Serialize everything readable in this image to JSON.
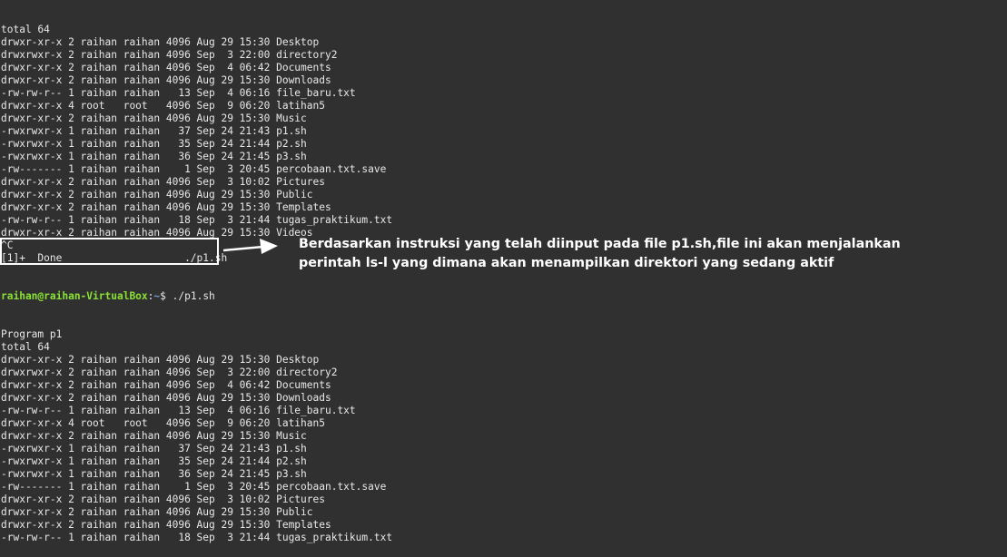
{
  "terminal": {
    "lines_before": [
      "total 64",
      "drwxr-xr-x 2 raihan raihan 4096 Aug 29 15:30 Desktop",
      "drwxrwxr-x 2 raihan raihan 4096 Sep  3 22:00 directory2",
      "drwxr-xr-x 2 raihan raihan 4096 Sep  4 06:42 Documents",
      "drwxr-xr-x 2 raihan raihan 4096 Aug 29 15:30 Downloads",
      "-rw-rw-r-- 1 raihan raihan   13 Sep  4 06:16 file_baru.txt",
      "drwxr-xr-x 4 root   root   4096 Sep  9 06:20 latihan5",
      "drwxr-xr-x 2 raihan raihan 4096 Aug 29 15:30 Music",
      "-rwxrwxr-x 1 raihan raihan   37 Sep 24 21:43 p1.sh",
      "-rwxrwxr-x 1 raihan raihan   35 Sep 24 21:44 p2.sh",
      "-rwxrwxr-x 1 raihan raihan   36 Sep 24 21:45 p3.sh",
      "-rw------- 1 raihan raihan    1 Sep  3 20:45 percobaan.txt.save",
      "drwxr-xr-x 2 raihan raihan 4096 Sep  3 10:02 Pictures",
      "drwxr-xr-x 2 raihan raihan 4096 Aug 29 15:30 Public",
      "drwxr-xr-x 2 raihan raihan 4096 Aug 29 15:30 Templates",
      "-rw-rw-r-- 1 raihan raihan   18 Sep  3 21:44 tugas_praktikum.txt",
      "drwxr-xr-x 2 raihan raihan 4096 Aug 29 15:30 Videos",
      "^C",
      "[1]+  Done                    ./p1.sh"
    ],
    "prompt": {
      "user_host": "raihan@raihan-VirtualBox",
      "separator": ":",
      "path": "~",
      "symbol": "$ ",
      "command": "./p1.sh"
    },
    "lines_after": [
      "Program p1",
      "total 64",
      "drwxr-xr-x 2 raihan raihan 4096 Aug 29 15:30 Desktop",
      "drwxrwxr-x 2 raihan raihan 4096 Sep  3 22:00 directory2",
      "drwxr-xr-x 2 raihan raihan 4096 Sep  4 06:42 Documents",
      "drwxr-xr-x 2 raihan raihan 4096 Aug 29 15:30 Downloads",
      "-rw-rw-r-- 1 raihan raihan   13 Sep  4 06:16 file_baru.txt",
      "drwxr-xr-x 4 root   root   4096 Sep  9 06:20 latihan5",
      "drwxr-xr-x 2 raihan raihan 4096 Aug 29 15:30 Music",
      "-rwxrwxr-x 1 raihan raihan   37 Sep 24 21:43 p1.sh",
      "-rwxrwxr-x 1 raihan raihan   35 Sep 24 21:44 p2.sh",
      "-rwxrwxr-x 1 raihan raihan   36 Sep 24 21:45 p3.sh",
      "-rw------- 1 raihan raihan    1 Sep  3 20:45 percobaan.txt.save",
      "drwxr-xr-x 2 raihan raihan 4096 Sep  3 10:02 Pictures",
      "drwxr-xr-x 2 raihan raihan 4096 Aug 29 15:30 Public",
      "drwxr-xr-x 2 raihan raihan 4096 Aug 29 15:30 Templates",
      "-rw-rw-r-- 1 raihan raihan   18 Sep  3 21:44 tugas_praktikum.txt"
    ]
  },
  "annotation": {
    "line1": "Berdasarkan instruksi yang telah diinput pada file p1.sh,file ini akan menjalankan",
    "line2": "perintah ls-l yang dimana akan menampilkan direktori yang sedang aktif"
  },
  "colors": {
    "background": "#303030",
    "text": "#e8e8e8",
    "prompt_user": "#8ae234",
    "prompt_path": "#729fcf",
    "annotation": "#ffffff"
  }
}
